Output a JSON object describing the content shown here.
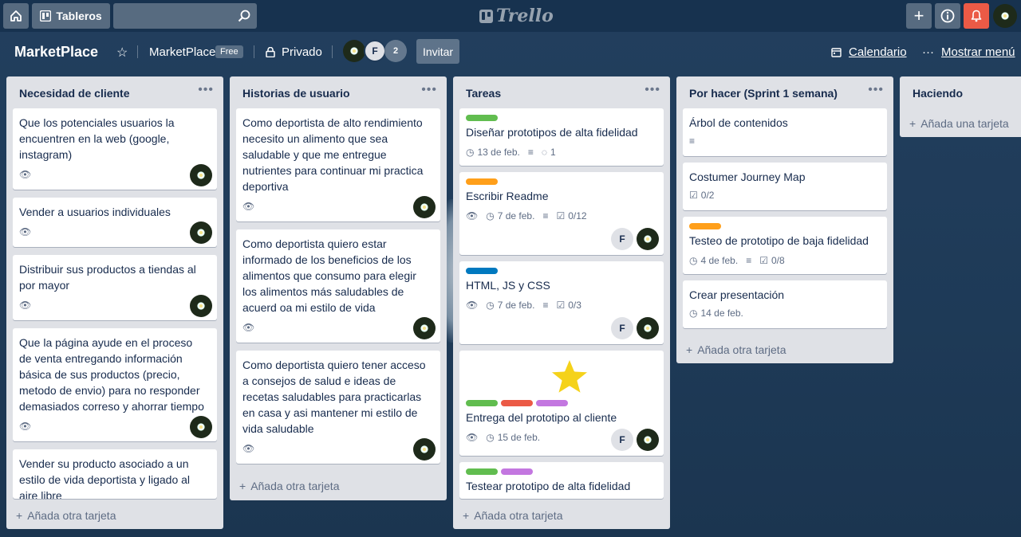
{
  "topbar": {
    "boards_label": "Tableros",
    "search_placeholder": "",
    "logo_text": "Trello"
  },
  "board": {
    "title": "MarketPlace",
    "team": "MarketPlace",
    "team_badge": "Free",
    "visibility": "Privado",
    "member_count": "2",
    "member_initial": "F",
    "invite_label": "Invitar",
    "calendar_label": "Calendario",
    "menu_label": "Mostrar menú"
  },
  "colors": {
    "green": "#61bd4f",
    "orange": "#ff9f1a",
    "blue": "#0079bf",
    "red": "#eb5a46",
    "purple": "#c377e0"
  },
  "lists": [
    {
      "title": "Necesidad de cliente",
      "add_label": "Añada otra tarjeta",
      "cards": [
        {
          "text": "Que los potenciales usuarios la encuentren en la web (google, instagram)"
        },
        {
          "text": "Vender a usuarios individuales"
        },
        {
          "text": "Distribuir sus productos a tiendas al por mayor"
        },
        {
          "text": "Que la página ayude en el proceso de venta entregando información básica de sus productos (precio, metodo de envio) para no responder demasiados correso y ahorrar tiempo"
        },
        {
          "text": "Vender su producto asociado a un estilo de vida deportista y ligado al aire libre"
        }
      ]
    },
    {
      "title": "Historias de usuario",
      "add_label": "Añada otra tarjeta",
      "cards": [
        {
          "text": "Como deportista de alto rendimiento necesito un alimento que sea saludable y que me entregue nutrientes para continuar mi practica deportiva"
        },
        {
          "text": "Como deportista quiero estar informado de los beneficios de los alimentos que consumo para elegir los alimentos más saludables de acuerd oa mi estilo de vida"
        },
        {
          "text": "Como deportista quiero tener acceso a consejos de salud e ideas de recetas saludables para practicarlas en casa y asi mantener mi estilo de vida saludable"
        }
      ]
    },
    {
      "title": "Tareas",
      "add_label": "Añada otra tarjeta",
      "cards": [
        {
          "text": "Diseñar prototipos de alta fidelidad",
          "due": "13 de feb.",
          "comments": "1"
        },
        {
          "text": "Escribir Readme",
          "due": "7 de feb.",
          "checklist": "0/12"
        },
        {
          "text": "HTML, JS y CSS",
          "due": "7 de feb.",
          "checklist": "0/3"
        },
        {
          "text": "Entrega del prototipo al cliente",
          "due": "15 de feb."
        },
        {
          "text": "Testear prototipo de alta fidelidad"
        }
      ]
    },
    {
      "title": "Por hacer (Sprint 1 semana)",
      "add_label": "Añada otra tarjeta",
      "cards": [
        {
          "text": "Árbol de contenidos"
        },
        {
          "text": "Costumer Journey Map",
          "checklist": "0/2"
        },
        {
          "text": "Testeo de prototipo de baja fidelidad",
          "due": "4 de feb.",
          "checklist": "0/8"
        },
        {
          "text": "Crear presentación",
          "due": "14 de feb."
        }
      ]
    },
    {
      "title": "Haciendo",
      "add_label": "Añada una tarjeta",
      "cards": []
    }
  ]
}
